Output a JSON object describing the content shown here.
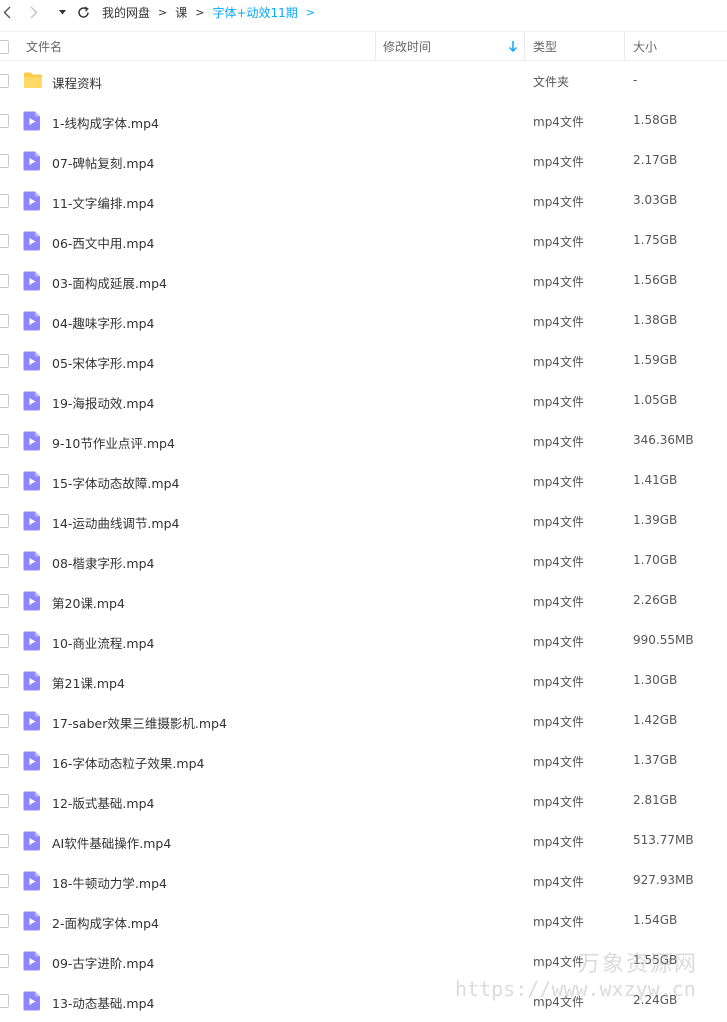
{
  "toolbar": {
    "back_icon": "chevron-left-icon",
    "forward_icon": "chevron-right-icon",
    "history_icon": "caret-down-icon",
    "refresh_icon": "refresh-icon"
  },
  "breadcrumb": {
    "items": [
      "我的网盘",
      "课",
      "字体+动效11期"
    ]
  },
  "table": {
    "columns": {
      "name": "文件名",
      "mtime": "修改时间",
      "type": "类型",
      "size": "大小"
    },
    "rows": [
      {
        "name": "课程资料",
        "type": "文件夹",
        "size": "-",
        "icon": "folder-icon"
      },
      {
        "name": "1-线构成字体.mp4",
        "type": "mp4文件",
        "size": "1.58GB",
        "icon": "video-file-icon"
      },
      {
        "name": "07-碑帖复刻.mp4",
        "type": "mp4文件",
        "size": "2.17GB",
        "icon": "video-file-icon"
      },
      {
        "name": "11-文字编排.mp4",
        "type": "mp4文件",
        "size": "3.03GB",
        "icon": "video-file-icon"
      },
      {
        "name": "06-西文中用.mp4",
        "type": "mp4文件",
        "size": "1.75GB",
        "icon": "video-file-icon"
      },
      {
        "name": "03-面构成延展.mp4",
        "type": "mp4文件",
        "size": "1.56GB",
        "icon": "video-file-icon"
      },
      {
        "name": "04-趣味字形.mp4",
        "type": "mp4文件",
        "size": "1.38GB",
        "icon": "video-file-icon"
      },
      {
        "name": "05-宋体字形.mp4",
        "type": "mp4文件",
        "size": "1.59GB",
        "icon": "video-file-icon"
      },
      {
        "name": "19-海报动效.mp4",
        "type": "mp4文件",
        "size": "1.05GB",
        "icon": "video-file-icon"
      },
      {
        "name": "9-10节作业点评.mp4",
        "type": "mp4文件",
        "size": "346.36MB",
        "icon": "video-file-icon"
      },
      {
        "name": "15-字体动态故障.mp4",
        "type": "mp4文件",
        "size": "1.41GB",
        "icon": "video-file-icon"
      },
      {
        "name": "14-运动曲线调节.mp4",
        "type": "mp4文件",
        "size": "1.39GB",
        "icon": "video-file-icon"
      },
      {
        "name": "08-楷隶字形.mp4",
        "type": "mp4文件",
        "size": "1.70GB",
        "icon": "video-file-icon"
      },
      {
        "name": "第20课.mp4",
        "type": "mp4文件",
        "size": "2.26GB",
        "icon": "video-file-icon"
      },
      {
        "name": "10-商业流程.mp4",
        "type": "mp4文件",
        "size": "990.55MB",
        "icon": "video-file-icon"
      },
      {
        "name": "第21课.mp4",
        "type": "mp4文件",
        "size": "1.30GB",
        "icon": "video-file-icon"
      },
      {
        "name": "17-saber效果三维摄影机.mp4",
        "type": "mp4文件",
        "size": "1.42GB",
        "icon": "video-file-icon"
      },
      {
        "name": "16-字体动态粒子效果.mp4",
        "type": "mp4文件",
        "size": "1.37GB",
        "icon": "video-file-icon"
      },
      {
        "name": "12-版式基础.mp4",
        "type": "mp4文件",
        "size": "2.81GB",
        "icon": "video-file-icon"
      },
      {
        "name": "AI软件基础操作.mp4",
        "type": "mp4文件",
        "size": "513.77MB",
        "icon": "video-file-icon"
      },
      {
        "name": "18-牛顿动力学.mp4",
        "type": "mp4文件",
        "size": "927.93MB",
        "icon": "video-file-icon"
      },
      {
        "name": "2-面构成字体.mp4",
        "type": "mp4文件",
        "size": "1.54GB",
        "icon": "video-file-icon"
      },
      {
        "name": "09-古字进阶.mp4",
        "type": "mp4文件",
        "size": "1.55GB",
        "icon": "video-file-icon"
      },
      {
        "name": "13-动态基础.mp4",
        "type": "mp4文件",
        "size": "2.24GB",
        "icon": "video-file-icon"
      }
    ]
  },
  "watermark": {
    "title": "万象资源网",
    "url": "https://www.wxzyw.cn"
  },
  "colors": {
    "accent": "#06a7ff",
    "folder": "#ffc94d",
    "video": "#8c86ff"
  }
}
